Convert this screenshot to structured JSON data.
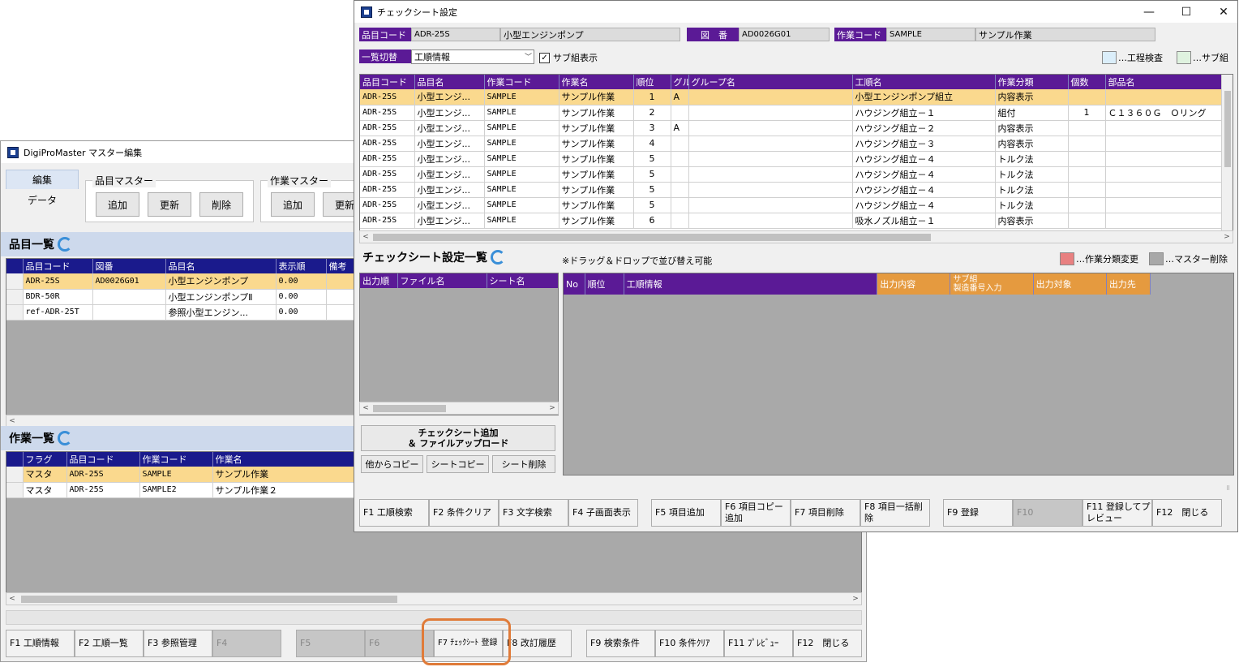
{
  "win1": {
    "title": "DigiProMaster マスター編集",
    "tabs": [
      "編集",
      "データ"
    ],
    "item_master": {
      "label": "品目マスター",
      "buttons": [
        "追加",
        "更新",
        "削除"
      ]
    },
    "work_master": {
      "label": "作業マスター",
      "buttons": [
        "追加",
        "更新"
      ]
    },
    "item_list": {
      "title": "品目一覧",
      "columns": [
        "品目コード",
        "図番",
        "品目名",
        "表示順",
        "備考"
      ],
      "rows": [
        [
          "ADR-25S",
          "AD0026G01",
          "小型エンジンポンプ",
          "0.00",
          ""
        ],
        [
          "BDR-50R",
          "",
          "小型エンジンポンプⅡ",
          "0.00",
          ""
        ],
        [
          "ref-ADR-25T",
          "",
          "参照小型エンジン...",
          "0.00",
          ""
        ]
      ]
    },
    "work_list": {
      "title": "作業一覧",
      "columns": [
        "フラグ",
        "品目コード",
        "作業コード",
        "作業名"
      ],
      "rows": [
        [
          "マスタ",
          "ADR-25S",
          "SAMPLE",
          "サンプル作業"
        ],
        [
          "マスタ",
          "ADR-25S",
          "SAMPLE2",
          "サンプル作業２"
        ]
      ]
    },
    "fkeys": [
      "F1 工順情報",
      "F2 工順一覧",
      "F3 参照管理",
      "F4",
      "F5",
      "F6",
      "F7 ﾁｪｯｸｼｰﾄ 登録",
      "F8 改訂履歴",
      "F9 検索条件",
      "F10 条件ｸﾘｱ",
      "F11 ﾌﾟﾚﾋﾞｭｰ",
      "F12　閉じる"
    ]
  },
  "win2": {
    "title": "チェックシート設定",
    "controls": {
      "minimize": "—",
      "maximize": "☐",
      "close": "✕"
    },
    "header": {
      "item_code_label": "品目コード",
      "item_code": "ADR-25S",
      "item_name": "小型エンジンポンプ",
      "drawing_label": "図　番",
      "drawing": "AD0026G01",
      "work_code_label": "作業コード",
      "work_code": "SAMPLE",
      "work_name": "サンプル作業",
      "switch_label": "一覧切替",
      "switch_value": "工順情報",
      "sub_display_label": "サブ組表示",
      "sub_display_check": "✓",
      "legend_process": "…工程検査",
      "legend_sub": "…サブ組"
    },
    "process_table": {
      "columns": [
        "品目コード",
        "品目名",
        "作業コード",
        "作業名",
        "順位",
        "グル",
        "グループ名",
        "工順名",
        "作業分類",
        "個数",
        "部品名"
      ],
      "rows": [
        [
          "ADR-25S",
          "小型エンジ...",
          "SAMPLE",
          "サンプル作業",
          "1",
          "A",
          "",
          "小型エンジンポンプ組立",
          "内容表示",
          "",
          ""
        ],
        [
          "ADR-25S",
          "小型エンジ...",
          "SAMPLE",
          "サンプル作業",
          "2",
          "",
          "",
          "ハウジング組立－１",
          "組付",
          "1",
          "Ｃ１３６０Ｇ　Ｏリング"
        ],
        [
          "ADR-25S",
          "小型エンジ...",
          "SAMPLE",
          "サンプル作業",
          "3",
          "A",
          "",
          "ハウジング組立－２",
          "内容表示",
          "",
          ""
        ],
        [
          "ADR-25S",
          "小型エンジ...",
          "SAMPLE",
          "サンプル作業",
          "4",
          "",
          "",
          "ハウジング組立－３",
          "内容表示",
          "",
          ""
        ],
        [
          "ADR-25S",
          "小型エンジ...",
          "SAMPLE",
          "サンプル作業",
          "5",
          "",
          "",
          "ハウジング組立－４",
          "トルク法",
          "",
          ""
        ],
        [
          "ADR-25S",
          "小型エンジ...",
          "SAMPLE",
          "サンプル作業",
          "5",
          "",
          "",
          "ハウジング組立－４",
          "トルク法",
          "",
          ""
        ],
        [
          "ADR-25S",
          "小型エンジ...",
          "SAMPLE",
          "サンプル作業",
          "5",
          "",
          "",
          "ハウジング組立－４",
          "トルク法",
          "",
          ""
        ],
        [
          "ADR-25S",
          "小型エンジ...",
          "SAMPLE",
          "サンプル作業",
          "5",
          "",
          "",
          "ハウジング組立－４",
          "トルク法",
          "",
          ""
        ],
        [
          "ADR-25S",
          "小型エンジ...",
          "SAMPLE",
          "サンプル作業",
          "6",
          "",
          "",
          "吸水ノズル組立－１",
          "内容表示",
          "",
          ""
        ]
      ]
    },
    "checksheet": {
      "title": "チェックシート設定一覧",
      "drag_note": "※ドラッグ＆ドロップで並び替え可能",
      "legend_change": "…作業分類変更",
      "legend_delete": "…マスター削除",
      "file_columns": [
        "出力順",
        "ファイル名",
        "シート名"
      ],
      "detail_columns": [
        "No",
        "順位",
        "工順情報",
        "出力内容",
        "サブ組\n製造番号入力",
        "出力対象",
        "出力先"
      ],
      "add_button_line1": "チェックシート追加",
      "add_button_line2": "＆ ファイルアップロード",
      "copy_from_other": "他からコピー",
      "sheet_copy": "シートコピー",
      "sheet_delete": "シート削除"
    },
    "fkeys": [
      "F1 工順検索",
      "F2 条件クリア",
      "F3 文字検索",
      "F4 子画面表示",
      "F5 項目追加",
      "F6 項目コピー追加",
      "F7 項目削除",
      "F8 項目一括削除",
      "F9 登録",
      "F10",
      "F11 登録してプレビュー",
      "F12　閉じる"
    ]
  },
  "colors": {
    "purple": "#5b1a96",
    "navy": "#1a1a8c",
    "selected_row": "#fad98e",
    "orange_header": "#e59a3f",
    "highlight": "#e07b39"
  }
}
